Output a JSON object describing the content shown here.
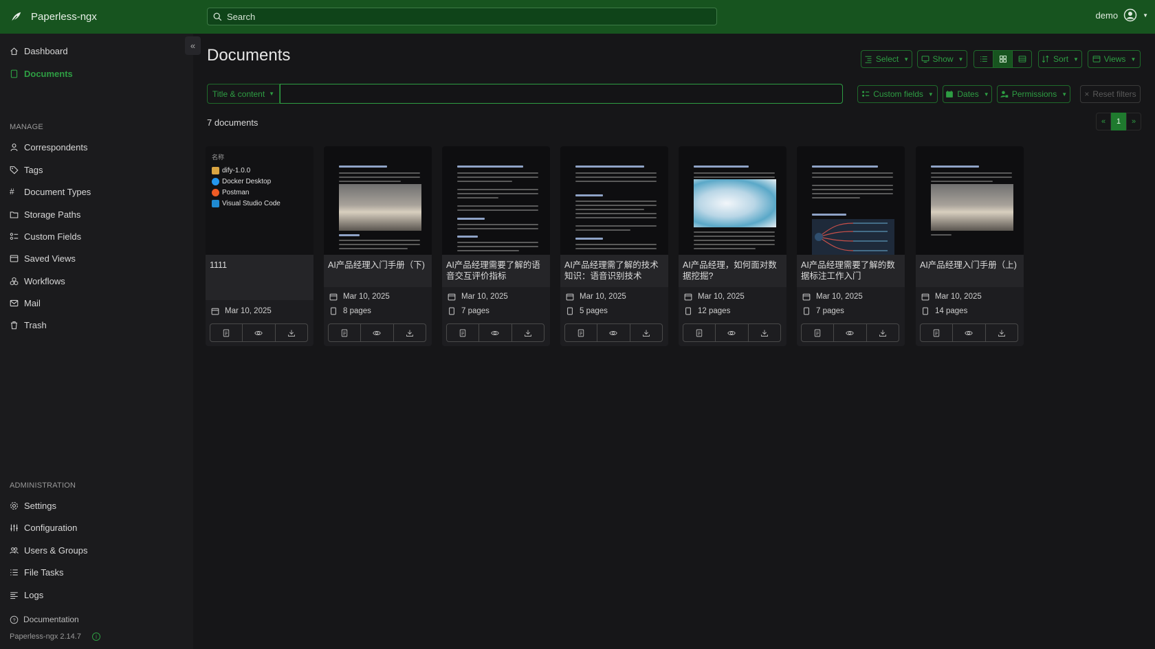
{
  "app": {
    "name": "Paperless-ngx",
    "user": "demo"
  },
  "search": {
    "placeholder": "Search"
  },
  "sidebar": {
    "main": [
      {
        "label": "Dashboard",
        "icon": "house-icon"
      },
      {
        "label": "Documents",
        "icon": "file-icon",
        "active": true
      }
    ],
    "manage_label": "MANAGE",
    "manage": [
      {
        "label": "Correspondents",
        "icon": "person-icon"
      },
      {
        "label": "Tags",
        "icon": "tag-icon"
      },
      {
        "label": "Document Types",
        "icon": "hash-icon"
      },
      {
        "label": "Storage Paths",
        "icon": "folder-icon"
      },
      {
        "label": "Custom Fields",
        "icon": "ui-radios-icon"
      },
      {
        "label": "Saved Views",
        "icon": "window-stack-icon"
      },
      {
        "label": "Workflows",
        "icon": "boxes-icon"
      },
      {
        "label": "Mail",
        "icon": "envelope-icon"
      },
      {
        "label": "Trash",
        "icon": "trash-icon"
      }
    ],
    "admin_label": "ADMINISTRATION",
    "admin": [
      {
        "label": "Settings",
        "icon": "gear-icon"
      },
      {
        "label": "Configuration",
        "icon": "sliders-icon"
      },
      {
        "label": "Users & Groups",
        "icon": "people-icon"
      },
      {
        "label": "File Tasks",
        "icon": "list-task-icon"
      },
      {
        "label": "Logs",
        "icon": "text-left-icon"
      }
    ],
    "documentation": "Documentation",
    "version": "Paperless-ngx 2.14.7"
  },
  "page": {
    "title": "Documents",
    "toolbar": {
      "select": "Select",
      "show": "Show",
      "sort": "Sort",
      "views": "Views"
    },
    "filter": {
      "mode": "Title & content",
      "value": "",
      "custom_fields": "Custom fields",
      "dates": "Dates",
      "permissions": "Permissions",
      "reset": "Reset filters"
    },
    "count": "7 documents",
    "pager": {
      "prev": "«",
      "current": "1",
      "next": "»"
    }
  },
  "documents": [
    {
      "title": "1111",
      "date": "Mar 10, 2025",
      "pages": "",
      "thumb": "screenshot",
      "thumb_items": [
        "名称",
        "dify-1.0.0",
        "Docker Desktop",
        "Postman",
        "Visual Studio Code"
      ]
    },
    {
      "title": "AI产品经理入门手册（下)",
      "date": "Mar 10, 2025",
      "pages": "8 pages",
      "thumb": "book"
    },
    {
      "title": "AI产品经理需要了解的语音交互评价指标",
      "date": "Mar 10, 2025",
      "pages": "7 pages",
      "thumb": "text"
    },
    {
      "title": "AI产品经理需了解的技术知识：语音识别技术",
      "date": "Mar 10, 2025",
      "pages": "5 pages",
      "thumb": "text"
    },
    {
      "title": "AI产品经理，如何面对数据挖掘?",
      "date": "Mar 10, 2025",
      "pages": "12 pages",
      "thumb": "data"
    },
    {
      "title": "AI产品经理需要了解的数据标注工作入门",
      "date": "Mar 10, 2025",
      "pages": "7 pages",
      "thumb": "mindmap"
    },
    {
      "title": "AI产品经理入门手册（上)",
      "date": "Mar 10, 2025",
      "pages": "14 pages",
      "thumb": "book"
    }
  ],
  "colors": {
    "topbar": "#17541f",
    "accent": "#2e9e43",
    "background": "#161618",
    "sidebar": "#1b1b1d"
  }
}
